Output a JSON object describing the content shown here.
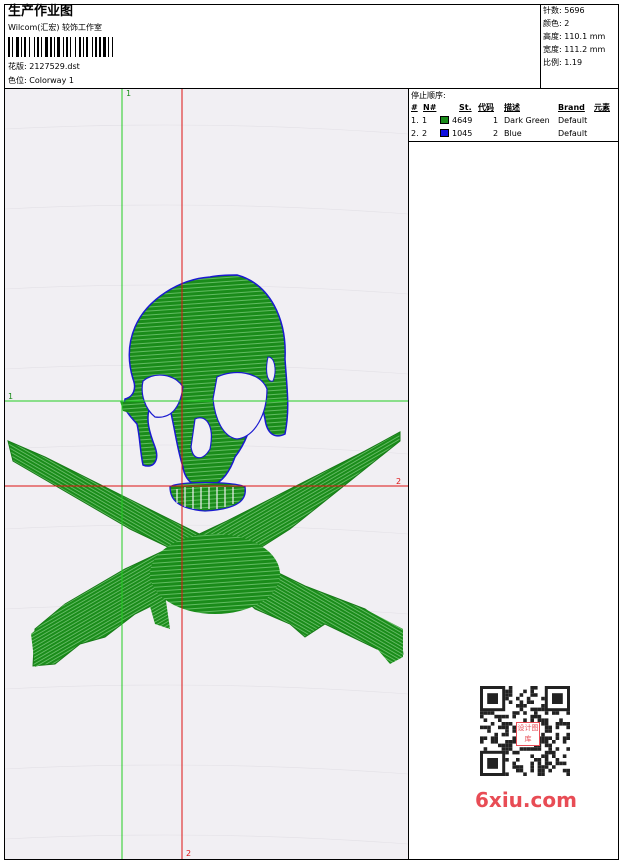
{
  "header": {
    "title": "生产作业图",
    "subtitle": "Wilcom(汇宏) 较饰工作室",
    "design_line": "花版: 2127529.dst",
    "colorway_line": "色位: Colorway 1"
  },
  "stats": [
    {
      "label": "针数",
      "value": "5696"
    },
    {
      "label": "颜色",
      "value": "2"
    },
    {
      "label": "高度",
      "value": "110.1 mm"
    },
    {
      "label": "宽度",
      "value": "111.2 mm"
    },
    {
      "label": "比例",
      "value": "1.19"
    }
  ],
  "stop_sequence": {
    "title": "停止顺序:",
    "headers": [
      "#",
      "N#",
      "St.",
      "代码",
      "描述",
      "Brand",
      "元素"
    ],
    "rows": [
      {
        "index": "1.",
        "n": "1",
        "color": "#1a8c1a",
        "stitches": "4649",
        "code": "1",
        "description": "Dark Green",
        "brand": "Default"
      },
      {
        "index": "2.",
        "n": "2",
        "color": "#1010e0",
        "stitches": "1045",
        "code": "2",
        "description": "Blue",
        "brand": "Default"
      }
    ]
  },
  "canvas": {
    "background": "#f1eff3",
    "guide_labels": {
      "green_top": "1",
      "green_left": "1",
      "red_right": "2",
      "red_bottom": "2"
    },
    "colors": {
      "green_guide": "#22cc22",
      "red_guide": "#dd1111",
      "fill_green": "#1a8c1a",
      "outline_blue": "#1a1ad0"
    }
  },
  "watermark": {
    "text": "6xiu.com",
    "badge": "设计图库"
  }
}
